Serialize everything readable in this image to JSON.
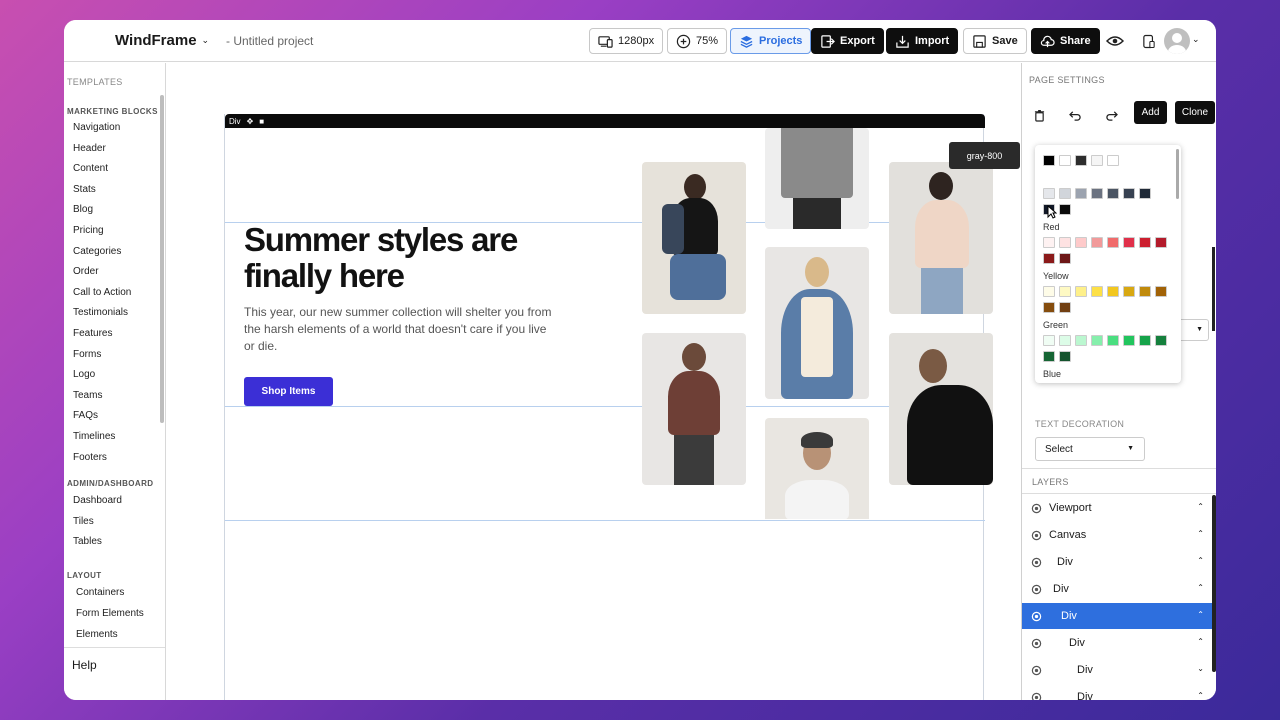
{
  "app": {
    "brand": "WindFrame",
    "project": "- Untitled project"
  },
  "toolbar": {
    "viewport": "1280px",
    "zoom": "75%",
    "projects": "Projects",
    "export": "Export",
    "import": "Import",
    "save": "Save",
    "share": "Share"
  },
  "sidebar": {
    "templates": "TEMPLATES",
    "marketing_title": "MARKETING BLOCKS",
    "marketing": [
      "Navigation",
      "Header",
      "Content",
      "Stats",
      "Blog",
      "Pricing",
      "Categories",
      "Order",
      "Call to Action",
      "Testimonials",
      "Features",
      "Forms",
      "Logo",
      "Teams",
      "FAQs",
      "Timelines",
      "Footers"
    ],
    "admin_title": "ADMIN/DASHBOARD",
    "admin": [
      "Dashboard",
      "Tiles",
      "Tables"
    ],
    "layout_title": "LAYOUT",
    "layout": [
      "Containers",
      "Form Elements",
      "Elements"
    ],
    "help": "Help"
  },
  "canvas": {
    "frame_label": "Div",
    "hero_title": "Summer styles are finally here",
    "hero_text": "This year, our new summer collection will shelter you from the harsh elements of a world that doesn't care if you live or die.",
    "cta": "Shop Items"
  },
  "right_panel": {
    "page_settings": "PAGE SETTINGS",
    "add": "Add",
    "clone": "Clone",
    "tooltip": "gray-800",
    "color_groups": [
      "Red",
      "Yellow",
      "Green",
      "Blue"
    ],
    "palette": {
      "gray_row1": [
        "#000000",
        "#ffffff",
        "#2d2d2d",
        "#f5f5f5",
        "#ffffff"
      ],
      "gray_row2": [
        "#e5e7eb",
        "#d1d5db",
        "#9ca3af",
        "#6b7280",
        "#4b5563",
        "#374151",
        "#1f2937"
      ],
      "gray_row3": [
        "#111827",
        "#0b0b0b"
      ],
      "red": [
        "#fef2f2",
        "#fee2e2",
        "#fecaca",
        "#f19a9a",
        "#f06b6b",
        "#e0304a",
        "#cc1f2f",
        "#b31b2b",
        "#8b1a1a",
        "#6d1717"
      ],
      "yellow": [
        "#fefce8",
        "#fef9c3",
        "#fef08a",
        "#fde047",
        "#f2c71f",
        "#d8a812",
        "#c08a0c",
        "#a16207",
        "#854d0e",
        "#713f12"
      ],
      "green": [
        "#f0fdf4",
        "#dcfce7",
        "#bbf7d0",
        "#86efac",
        "#4ade80",
        "#22c55e",
        "#16a34a",
        "#15803d",
        "#166534",
        "#14532d"
      ]
    },
    "text_decoration_label": "TEXT DECORATION",
    "text_decoration_value": "Select",
    "layers_title": "LAYERS",
    "layers": [
      {
        "label": "Viewport",
        "chev": "⌃"
      },
      {
        "label": "Canvas",
        "chev": "⌃"
      },
      {
        "label": "Div",
        "chev": "⌃"
      },
      {
        "label": "Div",
        "chev": "⌃"
      },
      {
        "label": "Div",
        "chev": "⌃"
      },
      {
        "label": "Div",
        "chev": "⌃"
      },
      {
        "label": "Div",
        "chev": "⌄"
      },
      {
        "label": "Div",
        "chev": "⌃"
      },
      {
        "label": "Div",
        "chev": ""
      }
    ]
  }
}
